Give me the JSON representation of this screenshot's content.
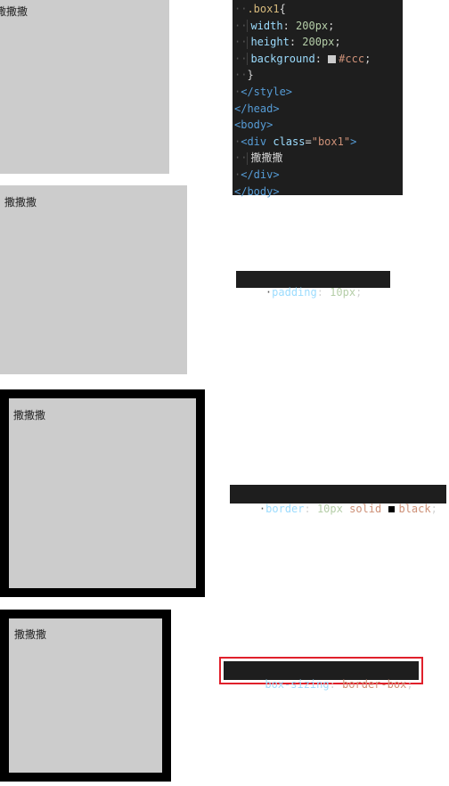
{
  "demo": {
    "text": "撒撒撒"
  },
  "code_block": {
    "lines": [
      {
        "dots": "··",
        "tokens": [
          {
            "c": "sel",
            "t": ".box1"
          },
          {
            "c": "punc",
            "t": "{"
          }
        ]
      },
      {
        "dots": "",
        "guide": true,
        "tokens": [
          {
            "c": "prop",
            "t": "width"
          },
          {
            "c": "punc",
            "t": ": "
          },
          {
            "c": "num",
            "t": "200px"
          },
          {
            "c": "punc",
            "t": ";"
          }
        ]
      },
      {
        "dots": "",
        "guide": true,
        "tokens": [
          {
            "c": "prop",
            "t": "height"
          },
          {
            "c": "punc",
            "t": ": "
          },
          {
            "c": "num",
            "t": "200px"
          },
          {
            "c": "punc",
            "t": ";"
          }
        ]
      },
      {
        "dots": "",
        "guide": true,
        "tokens": [
          {
            "c": "prop",
            "t": "background"
          },
          {
            "c": "punc",
            "t": ": "
          },
          {
            "c": "swatch",
            "t": "#cccccc"
          },
          {
            "c": "val",
            "t": "#ccc"
          },
          {
            "c": "punc",
            "t": ";"
          }
        ]
      },
      {
        "dots": "··",
        "tokens": [
          {
            "c": "punc",
            "t": "}"
          }
        ]
      },
      {
        "dots": "·",
        "tokens": [
          {
            "c": "tag",
            "t": "</style>"
          }
        ]
      },
      {
        "dots": "",
        "tokens": [
          {
            "c": "tag",
            "t": "</head>"
          }
        ]
      },
      {
        "dots": "",
        "tokens": [
          {
            "c": "tag",
            "t": "<body>"
          }
        ]
      },
      {
        "dots": "·",
        "tokens": [
          {
            "c": "tag",
            "t": "<div "
          },
          {
            "c": "attr",
            "t": "class"
          },
          {
            "c": "punc",
            "t": "="
          },
          {
            "c": "str",
            "t": "\"box1\""
          },
          {
            "c": "tag",
            "t": ">"
          }
        ]
      },
      {
        "dots": "",
        "guide": true,
        "tokens": [
          {
            "c": "txt",
            "t": "撒撒撒"
          }
        ]
      },
      {
        "dots": "·",
        "tokens": [
          {
            "c": "tag",
            "t": "</div>"
          }
        ]
      },
      {
        "dots": "",
        "tokens": [
          {
            "c": "tag",
            "t": "</body>"
          }
        ]
      }
    ]
  },
  "snippets": {
    "padding": {
      "prop": "padding",
      "sep": ": ",
      "value": "10px",
      "end": ";"
    },
    "border": {
      "prop": "border",
      "sep": ": ",
      "num": "10px",
      "kw": "solid",
      "color": "black",
      "end": ";"
    },
    "box_sizing": {
      "prop": "box-sizing",
      "sep": ": ",
      "value": "border-box",
      "end": ";"
    }
  },
  "colors": {
    "box_bg": "#cccccc",
    "border": "#000000",
    "highlight": "#e0202b",
    "editor_bg": "#1e1e1e"
  }
}
